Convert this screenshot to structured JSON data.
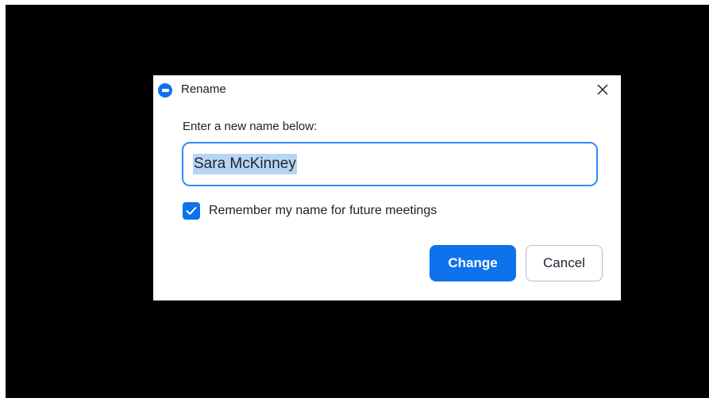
{
  "dialog": {
    "title": "Rename",
    "app_icon": "zoom-icon",
    "close_icon": "close-icon",
    "prompt": "Enter a new name below:",
    "name_input": {
      "value": "Sara McKinney",
      "selected": true
    },
    "remember_checkbox": {
      "label": "Remember my name for future meetings",
      "checked": true,
      "icon": "checkmark-icon"
    },
    "buttons": {
      "change_label": "Change",
      "cancel_label": "Cancel"
    }
  },
  "colors": {
    "accent": "#0e72ed",
    "input_border": "#2d8cff",
    "selection_highlight": "#b7d6f4",
    "backdrop": "#000000"
  }
}
